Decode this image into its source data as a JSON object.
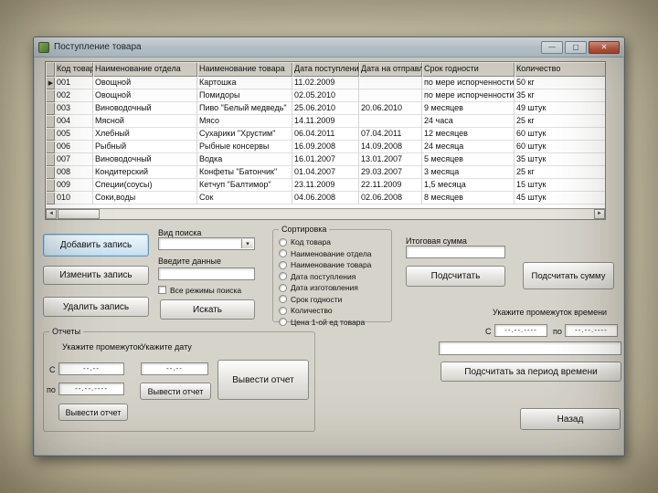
{
  "icons": {
    "minimize": "—",
    "maximize": "▢",
    "close": "✕",
    "row_marker": "▶",
    "combo_arrow": "▾",
    "scroll_left": "◄",
    "scroll_right": "►"
  },
  "window": {
    "title": "Поступление товара"
  },
  "grid": {
    "columns": [
      "Код товара",
      "Наименование отдела",
      "Наименование товара",
      "Дата поступления",
      "Дата на отправления",
      "Срок годности",
      "Количество"
    ],
    "selected_row": 0,
    "rows": [
      [
        "001",
        "Овощной",
        "Картошка",
        "11.02.2009",
        "",
        "по мере испорченности",
        "50 кг"
      ],
      [
        "002",
        "Овощной",
        "Помидоры",
        "02.05.2010",
        "",
        "по мере испорченности",
        "35 кг"
      ],
      [
        "003",
        "Виноводочный",
        "Пиво \"Белый медведь\"",
        "25.06.2010",
        "20.06.2010",
        "9 месяцев",
        "49 штук"
      ],
      [
        "004",
        "Мясной",
        "Мясо",
        "14.11.2009",
        "",
        "24 часа",
        "25 кг"
      ],
      [
        "005",
        "Хлебный",
        "Сухарики \"Хрустим\"",
        "06.04.2011",
        "07.04.2011",
        "12 месяцев",
        "60 штук"
      ],
      [
        "006",
        "Рыбный",
        "Рыбные консервы",
        "16.09.2008",
        "14.09.2008",
        "24 месяца",
        "60 штук"
      ],
      [
        "007",
        "Виноводочный",
        "Водка",
        "16.01.2007",
        "13.01.2007",
        "5 месяцев",
        "35 штук"
      ],
      [
        "008",
        "Кондитерский",
        "Конфеты \"Батончик\"",
        "01.04.2007",
        "29.03.2007",
        "3 месяца",
        "25 кг"
      ],
      [
        "009",
        "Специи(соусы)",
        "Кетчуп \"Балтимор\"",
        "23.11.2009",
        "22.11.2009",
        "1,5 месяца",
        "15 штук"
      ],
      [
        "010",
        "Соки,воды",
        "Сок",
        "04.06.2008",
        "02.06.2008",
        "8 месяцев",
        "45 штук"
      ]
    ]
  },
  "record_actions": {
    "add": "Добавить запись",
    "modify": "Изменить запись",
    "remove": "Удалить запись"
  },
  "search": {
    "type_label": "Вид поиска",
    "type_value": "",
    "input_label": "Введите данные",
    "input_value": "",
    "all_modes_label": "Все режимы поиска",
    "button": "Искать"
  },
  "sorting": {
    "title": "Сортировка",
    "options": [
      "Код товара",
      "Наименование отдела",
      "Наименование товара",
      "Дата поступления",
      "Дата изготовления",
      "Срок годности",
      "Количество",
      "Цена 1-ой ед товара"
    ]
  },
  "totals": {
    "sum_label": "Итоговая сумма",
    "sum_value": "",
    "calc_button": "Подсчитать",
    "calc_sum_button": "Подсчитать сумму",
    "period_label": "Укажите промежуток времени",
    "from_label": "С",
    "to_label": "по",
    "from_value": "--.--.----",
    "to_value": "--.--.----",
    "period_value": "",
    "calc_period_button": "Подсчитать за период времени"
  },
  "reports": {
    "title": "Отчеты",
    "range_label": "Укажите промежуток",
    "from_label": "С",
    "to_label": "по",
    "from_value": "--.--",
    "to_value": "--.--.----",
    "range_button": "Вывести отчет",
    "date_label": "Укажите дату",
    "date_value": "--.--",
    "date_button": "Вывести отчет",
    "all_button": "Вывести отчет"
  },
  "navigation": {
    "back_button": "Назад"
  }
}
